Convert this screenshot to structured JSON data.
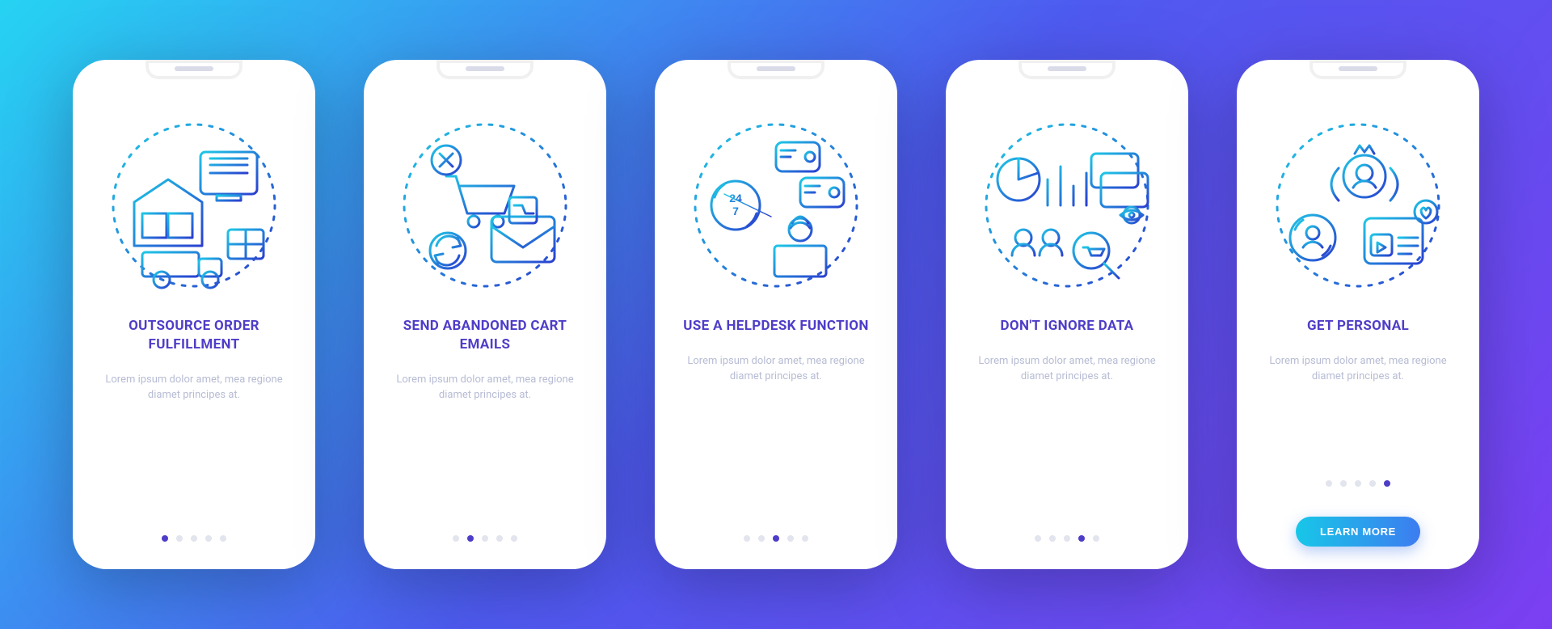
{
  "colors": {
    "bg_from": "#26D3F2",
    "bg_mid": "#4E5AF0",
    "bg_to": "#7B3FF2",
    "title": "#4E3DC8",
    "muted": "#B7BCD4",
    "dot_inactive": "#E2E4EE",
    "dot_active": "#4E3DC8",
    "cta_from": "#17C7E8",
    "cta_to": "#3D7CF0",
    "stroke_from": "#1EC8E6",
    "stroke_to": "#2A3FD0"
  },
  "lorem": "Lorem ipsum dolor amet, mea regione diamet principes at.",
  "screens": [
    {
      "id": "outsource",
      "title": "OUTSOURCE ORDER FULFILLMENT",
      "icon": "warehouse-delivery-icon",
      "active_index": 0
    },
    {
      "id": "abandoned",
      "title": "SEND ABANDONED CART EMAILS",
      "icon": "cart-email-icon",
      "active_index": 1
    },
    {
      "id": "helpdesk",
      "title": "USE A HELPDESK FUNCTION",
      "icon": "helpdesk-icon",
      "active_index": 2
    },
    {
      "id": "data",
      "title": "DON'T IGNORE DATA",
      "icon": "analytics-data-icon",
      "active_index": 3
    },
    {
      "id": "personal",
      "title": "GET PERSONAL",
      "icon": "personalization-icon",
      "active_index": 4,
      "cta": "LEARN MORE"
    }
  ],
  "total_dots": 5
}
